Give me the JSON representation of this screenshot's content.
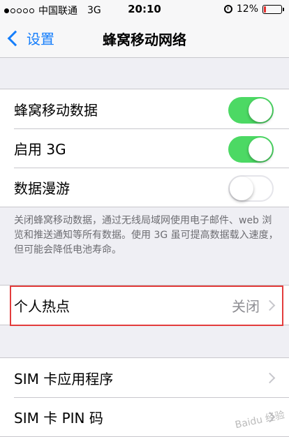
{
  "status_bar": {
    "carrier": "中国联通",
    "network": "3G",
    "time": "20:10",
    "battery": "12%",
    "battery_level": 0.12,
    "signal_bars": 1,
    "signal_total": 5
  },
  "nav": {
    "back_label": "设置",
    "title": "蜂窝移动网络"
  },
  "settings_group": [
    {
      "label": "蜂窝移动数据",
      "toggle": "on"
    },
    {
      "label": "启用 3G",
      "toggle": "on"
    },
    {
      "label": "数据漫游",
      "toggle": "off"
    }
  ],
  "footer_note": "关闭蜂窝移动数据，通过无线局域网使用电子邮件、web 浏览和推送通知等所有数据。使用 3G 虽可提高数据载入速度，但可能会降低电池寿命。",
  "hotspot": {
    "label": "个人热点",
    "value": "关闭"
  },
  "sim_group": [
    {
      "label": "SIM 卡应用程序"
    },
    {
      "label": "SIM 卡 PIN 码"
    }
  ],
  "watermark": "Baidu 经验",
  "colors": {
    "accent": "#157efb",
    "toggle_on": "#4cd964",
    "highlight": "#e33c3c"
  }
}
